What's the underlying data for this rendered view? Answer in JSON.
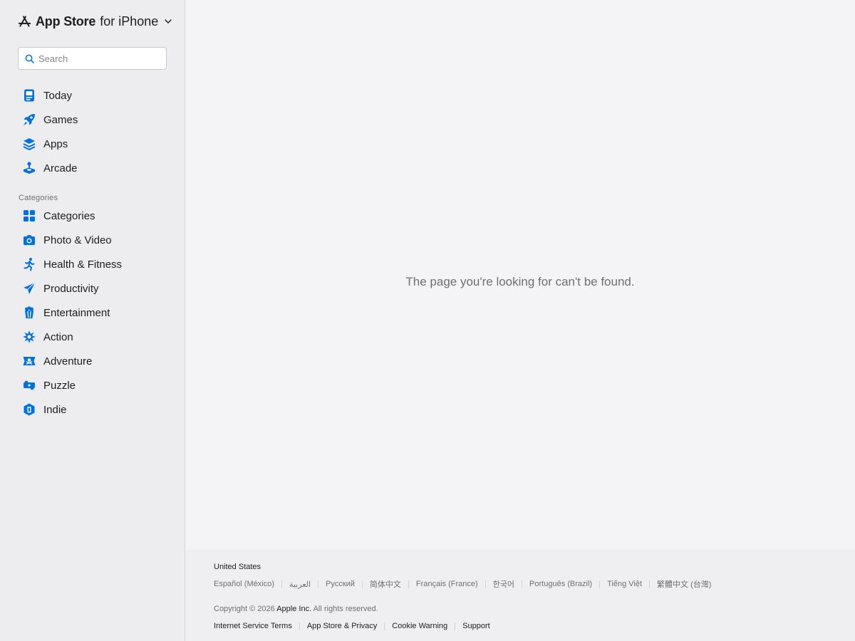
{
  "brand": {
    "name": "App Store",
    "suffix": "for iPhone",
    "logo_icon": "app-store-logo-icon",
    "chevron_icon": "chevron-down-icon"
  },
  "search": {
    "placeholder": "Search",
    "value": "",
    "icon": "search-icon"
  },
  "accent_color": "#0071e3",
  "sidebar": {
    "main_items": [
      {
        "label": "Today",
        "icon": "today-icon"
      },
      {
        "label": "Games",
        "icon": "rocket-icon"
      },
      {
        "label": "Apps",
        "icon": "layers-icon"
      },
      {
        "label": "Arcade",
        "icon": "joystick-icon"
      }
    ],
    "categories_heading": "Categories",
    "category_items": [
      {
        "label": "Categories",
        "icon": "grid-icon"
      },
      {
        "label": "Photo & Video",
        "icon": "camera-icon"
      },
      {
        "label": "Health & Fitness",
        "icon": "running-figure-icon"
      },
      {
        "label": "Productivity",
        "icon": "paper-plane-icon"
      },
      {
        "label": "Entertainment",
        "icon": "popcorn-icon"
      },
      {
        "label": "Action",
        "icon": "burst-icon"
      },
      {
        "label": "Adventure",
        "icon": "pirate-flag-icon"
      },
      {
        "label": "Puzzle",
        "icon": "puzzle-piece-icon"
      },
      {
        "label": "Indie",
        "icon": "indie-cube-icon"
      }
    ]
  },
  "main": {
    "message": "The page you're looking for can't be found."
  },
  "footer": {
    "country": "United States",
    "languages": [
      "Español (México)",
      "العربية",
      "Русский",
      "简体中文",
      "Français (France)",
      "한국어",
      "Português (Brazil)",
      "Tiếng Việt",
      "繁體中文 (台灣)"
    ],
    "copyright_prefix": "Copyright © 2026",
    "company": "Apple Inc.",
    "rights": "All rights reserved.",
    "legal_links": [
      "Internet Service Terms",
      "App Store & Privacy",
      "Cookie Warning",
      "Support"
    ]
  }
}
